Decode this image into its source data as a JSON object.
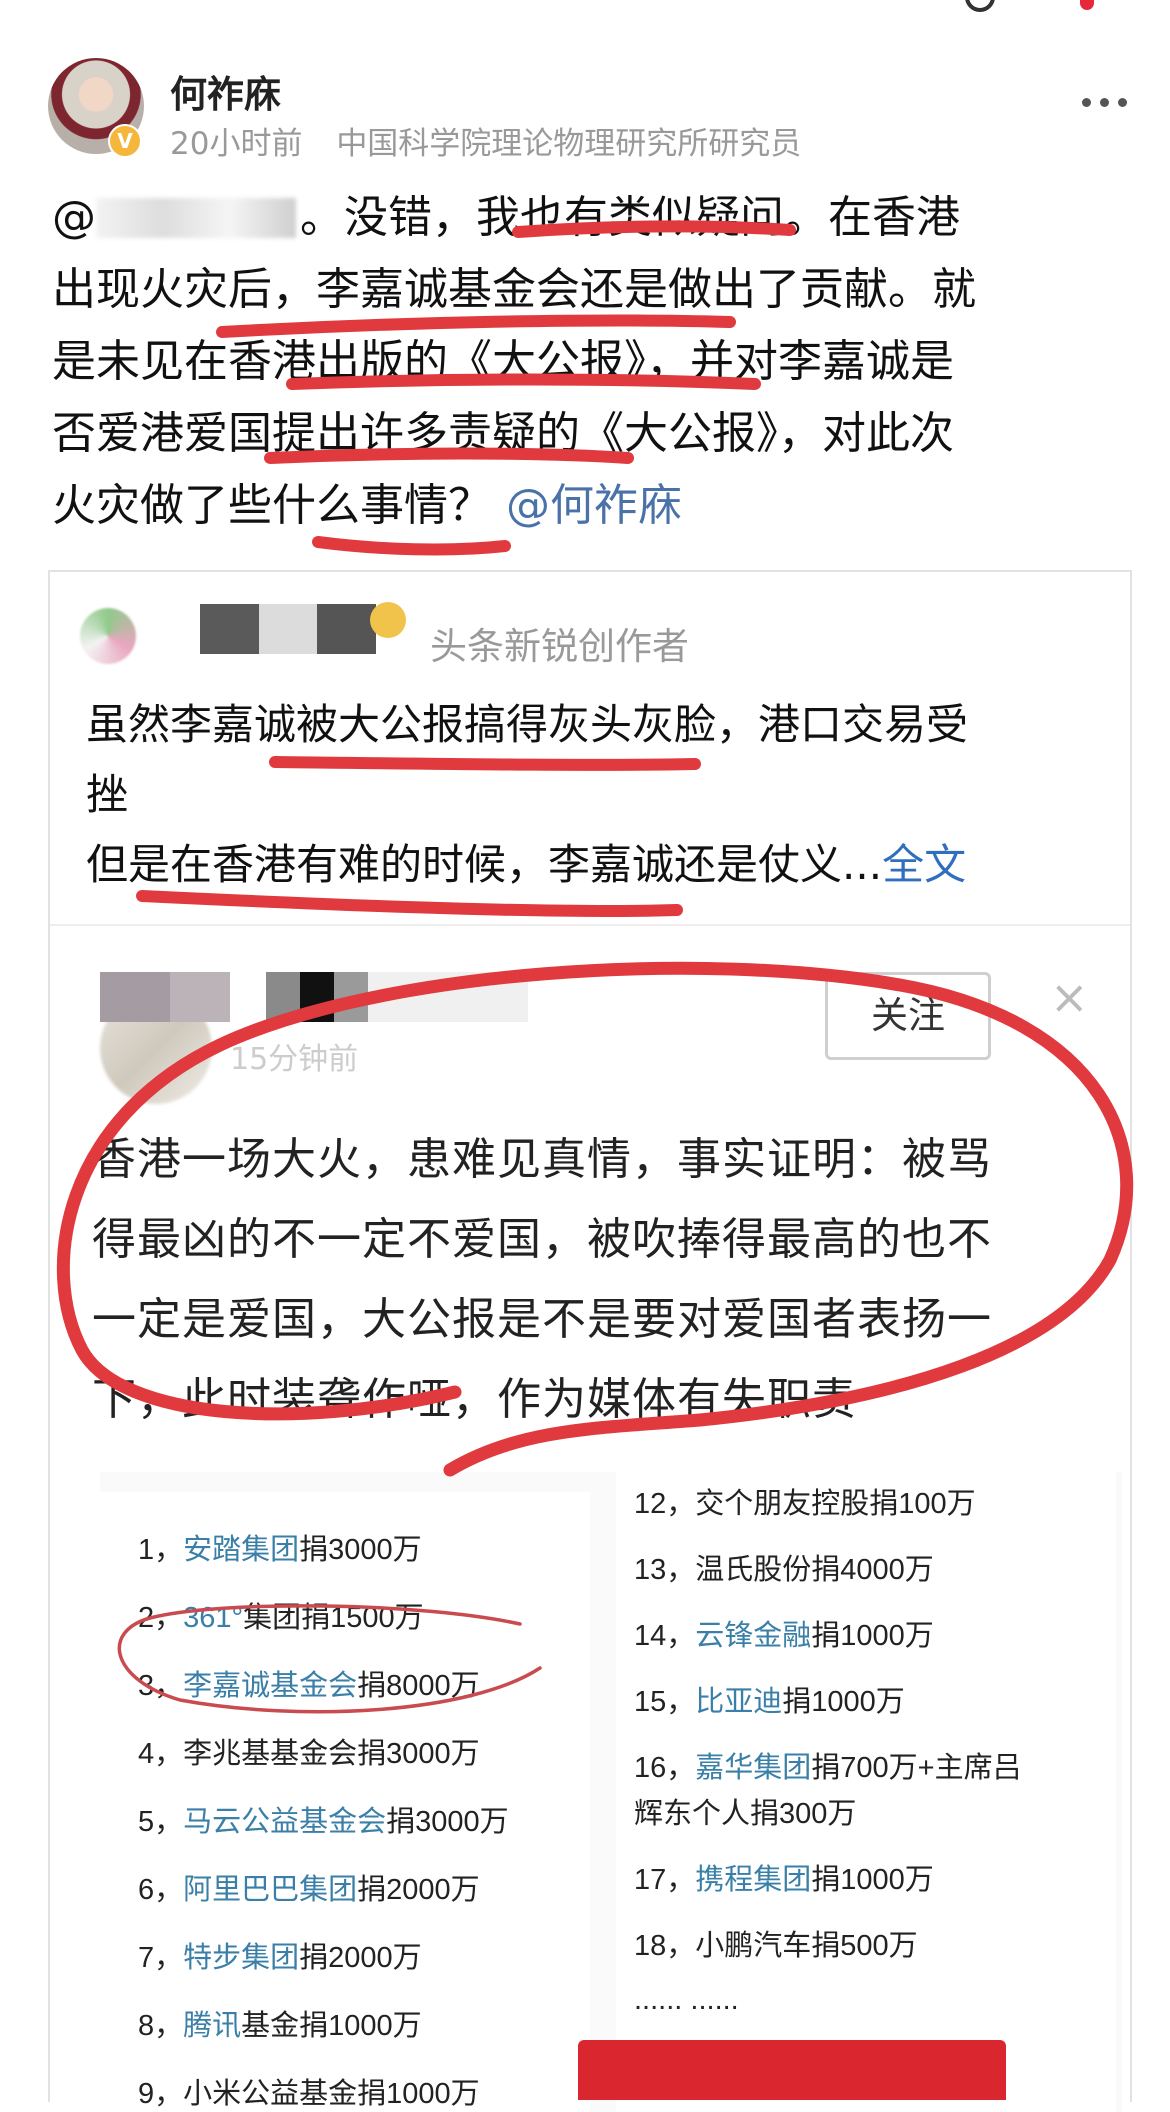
{
  "post": {
    "author": "何祚庥",
    "verified_badge": "V",
    "time": "20小时前",
    "author_title": "中国科学院理论物理研究所研究员",
    "text_prefix": "@",
    "text_line1_rest": "。没错，我也有类似疑问。在香港",
    "text_line2": "出现火灾后，李嘉诚基金会还是做出了贡献。就",
    "text_line3": "是未见在香港出版的《大公报》，并对李嘉诚是",
    "text_line4": "否爱港爱国提出许多责疑的《大公报》，对此次",
    "text_line5": "火灾做了些什么事情？",
    "mention": "@何祚庥"
  },
  "quoted": {
    "tag": "头条新锐创作者",
    "line1": "虽然李嘉诚被大公报搞得灰头灰脸，港口交易受",
    "line2": "挫",
    "line3": "但是在香港有难的时候，李嘉诚还是仗义...",
    "full_text_link": "全文"
  },
  "repost": {
    "time": "15分钟前",
    "follow_label": "关注",
    "close_glyph": "×",
    "lines": [
      "香港一场大火，患难见真情，事实证明：被骂",
      "得最凶的不一定不爱国，被吹捧得最高的也不",
      "一定是爱国，大公报是不是要对爱国者表扬一",
      "下，此时装聋作哑，作为媒体有失职责"
    ]
  },
  "donations": {
    "left": [
      {
        "num": "1，",
        "org": "安踏集团",
        "rest": "捐3000万"
      },
      {
        "num": "2，",
        "org": "361°",
        "rest": "集团捐1500万"
      },
      {
        "num": "3，",
        "org": "李嘉诚基金会",
        "rest": "捐8000万"
      },
      {
        "num": "4，",
        "org": "",
        "rest": "李兆基基金会捐3000万"
      },
      {
        "num": "5，",
        "org": "马云公益基金会",
        "rest": "捐3000万"
      },
      {
        "num": "6，",
        "org": "阿里巴巴集团",
        "rest": "捐2000万"
      },
      {
        "num": "7，",
        "org": "特步集团",
        "rest": "捐2000万"
      },
      {
        "num": "8，",
        "org": "腾讯",
        "rest": "基金捐1000万"
      },
      {
        "num": "9，",
        "org": "",
        "rest": "小米公益基金捐1000万"
      }
    ],
    "right": [
      {
        "num": "12，",
        "org": "",
        "rest": "交个朋友控股捐100万"
      },
      {
        "num": "13，",
        "org": "",
        "rest": "温氏股份捐4000万"
      },
      {
        "num": "14，",
        "org": "云锋金融",
        "rest": "捐1000万"
      },
      {
        "num": "15，",
        "org": "比亚迪",
        "rest": "捐1000万"
      },
      {
        "num": "16，",
        "org": "嘉华集团",
        "rest": "捐700万+主席吕"
      },
      {
        "num": "",
        "org": "",
        "rest": "辉东个人捐300万"
      },
      {
        "num": "17，",
        "org": "携程集团",
        "rest": "捐1000万"
      },
      {
        "num": "18，",
        "org": "",
        "rest": "小鹏汽车捐500万"
      },
      {
        "num": "",
        "org": "",
        "rest": "...... ......"
      }
    ]
  },
  "colors": {
    "link_blue": "#2f6fbd",
    "mention_blue": "#4a72a8",
    "org_teal": "#3a7fa8",
    "annotation_red": "#e03a3e",
    "meta_gray": "#999999"
  },
  "icons": [
    "more-icon",
    "verified-badge-icon",
    "close-icon",
    "search-icon"
  ]
}
